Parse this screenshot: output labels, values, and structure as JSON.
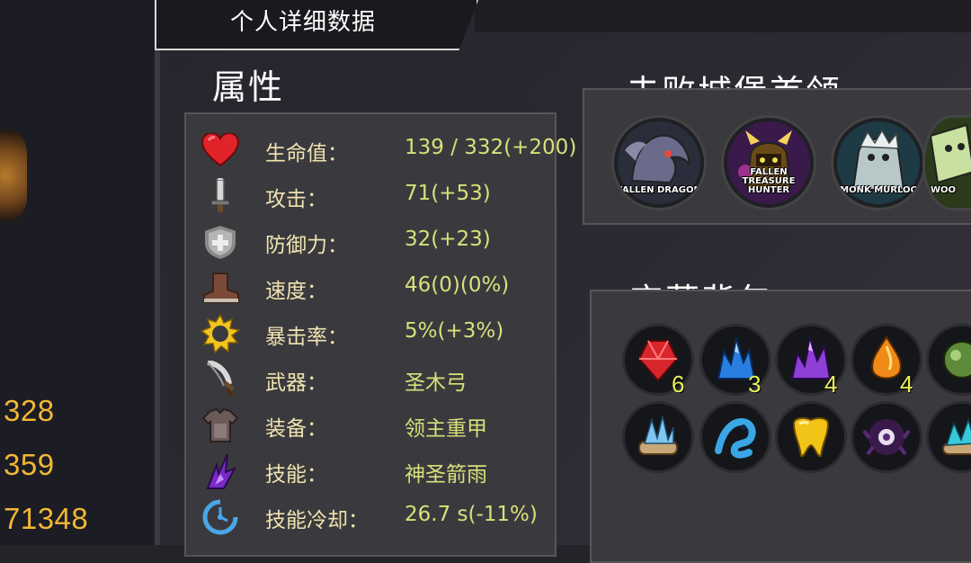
{
  "header": {
    "title": "个人详细数据"
  },
  "left_stats": [
    "328",
    "359",
    "71348"
  ],
  "attributes": {
    "title": "属性",
    "rows": [
      {
        "label": "生命值：",
        "value": "139 / 332(+200)",
        "icon": "heart-icon"
      },
      {
        "label": "攻击：",
        "value": "71(+53)",
        "icon": "sword-icon"
      },
      {
        "label": "防御力：",
        "value": "32(+23)",
        "icon": "shield-icon"
      },
      {
        "label": "速度：",
        "value": "46(0)(0%)",
        "icon": "boot-icon"
      },
      {
        "label": "暴击率：",
        "value": "5%(+3%)",
        "icon": "sun-icon"
      },
      {
        "label": "武器：",
        "value": "圣木弓",
        "icon": "weapon-icon"
      },
      {
        "label": "装备：",
        "value": "领主重甲",
        "icon": "armor-icon"
      },
      {
        "label": "技能：",
        "value": "神圣箭雨",
        "icon": "skill-icon"
      },
      {
        "label": "技能冷却：",
        "value": "26.7 s(-11%)",
        "icon": "cooldown-icon"
      }
    ]
  },
  "bosses": {
    "title": "击败城堡首领",
    "items": [
      {
        "name": "FALLEN DRAGON"
      },
      {
        "name": "FALLEN TREASURE HUNTER"
      },
      {
        "name": "MONK MURLOC"
      },
      {
        "name": "WOO"
      }
    ]
  },
  "treasures": {
    "title": "宝藏背包",
    "row1": [
      {
        "icon": "red-crystal-icon",
        "count": "6",
        "color": "#d8262c"
      },
      {
        "icon": "blue-crystal-icon",
        "count": "3",
        "color": "#2a7de1"
      },
      {
        "icon": "purple-crystal-icon",
        "count": "4",
        "color": "#8d3fd6"
      },
      {
        "icon": "orange-crystal-icon",
        "count": "4",
        "color": "#f08a18"
      },
      {
        "icon": "green-orb-icon",
        "count": "",
        "color": "#5e8a3a"
      }
    ],
    "row2": [
      {
        "icon": "ice-scroll-icon",
        "color": "#7fc6f0"
      },
      {
        "icon": "water-dragon-icon",
        "color": "#3aa6e6"
      },
      {
        "icon": "golden-tooth-icon",
        "color": "#f3c418"
      },
      {
        "icon": "dark-eye-icon",
        "color": "#5a2a7a"
      },
      {
        "icon": "cyan-scroll-icon",
        "color": "#38c8d8"
      }
    ]
  }
}
